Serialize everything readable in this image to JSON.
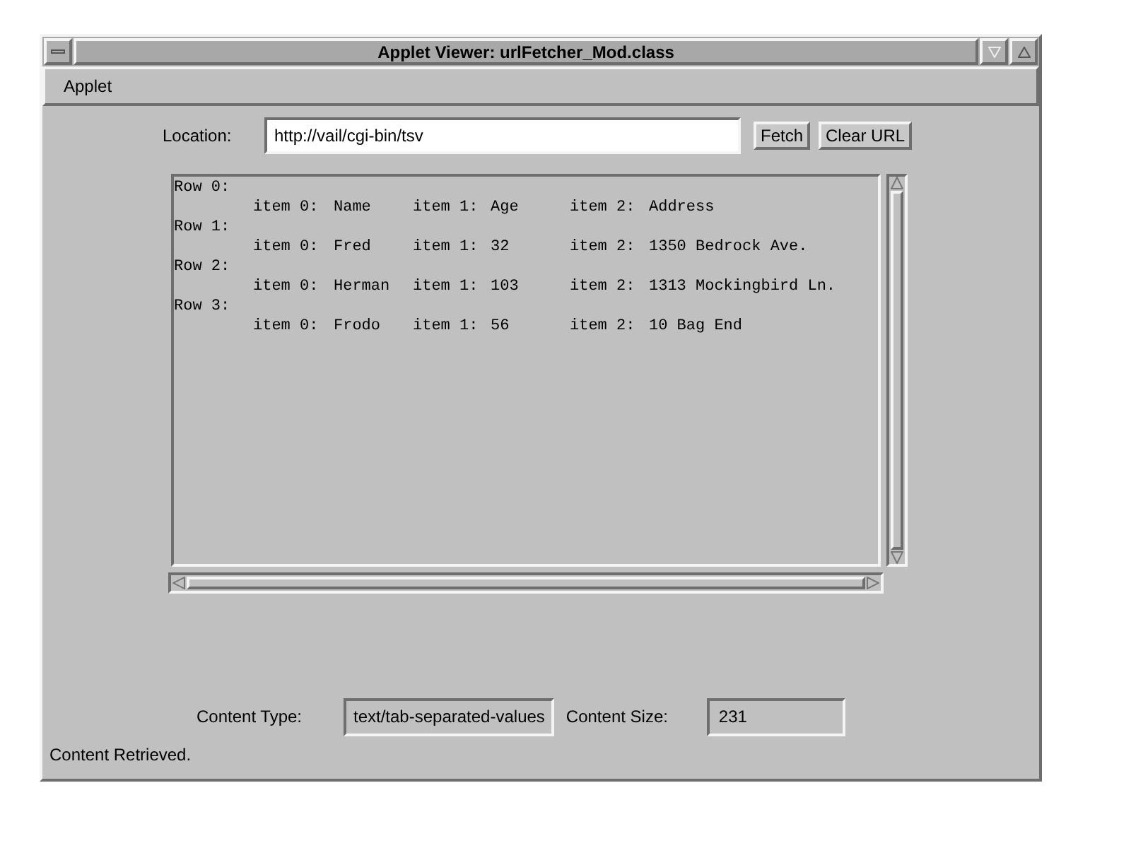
{
  "window": {
    "title": "Applet Viewer: urlFetcher_Mod.class"
  },
  "menu": [
    "Applet"
  ],
  "location": {
    "label": "Location:",
    "value": "http://vail/cgi-bin/tsv"
  },
  "buttons": [
    "Fetch",
    "Clear URL"
  ],
  "rows": [
    {
      "label": "Row 0:",
      "items": [
        {
          "label": "item 0:",
          "value": "Name"
        },
        {
          "label": "item 1:",
          "value": "Age"
        },
        {
          "label": "item 2:",
          "value": "Address"
        }
      ]
    },
    {
      "label": "Row 1:",
      "items": [
        {
          "label": "item 0:",
          "value": "Fred"
        },
        {
          "label": "item 1:",
          "value": "32"
        },
        {
          "label": "item 2:",
          "value": "1350 Bedrock Ave."
        }
      ]
    },
    {
      "label": "Row 2:",
      "items": [
        {
          "label": "item 0:",
          "value": "Herman"
        },
        {
          "label": "item 1:",
          "value": "103"
        },
        {
          "label": "item 2:",
          "value": "1313 Mockingbird Ln."
        }
      ]
    },
    {
      "label": "Row 3:",
      "items": [
        {
          "label": "item 0:",
          "value": "Frodo"
        },
        {
          "label": "item 1:",
          "value": "56"
        },
        {
          "label": "item 2:",
          "value": "10 Bag End"
        }
      ]
    }
  ],
  "content_type": {
    "label": "Content Type:",
    "value": "text/tab-separated-values"
  },
  "content_size": {
    "label": "Content Size:",
    "value": "231"
  },
  "status_bar": "Content Retrieved."
}
